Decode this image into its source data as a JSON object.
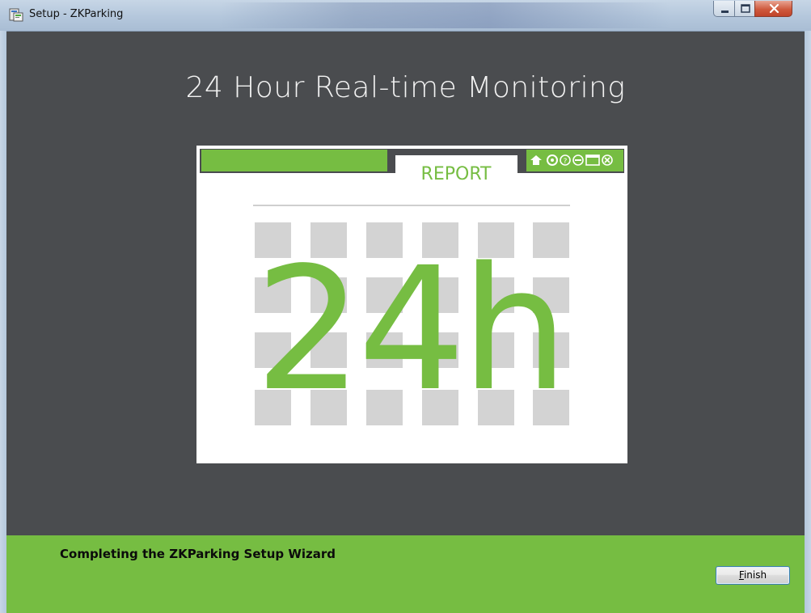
{
  "window": {
    "title": "Setup - ZKParking"
  },
  "banner": {
    "headline": "24 Hour Real-time Monitoring",
    "report_tab": "REPORT",
    "big_text": "24h",
    "accent_color": "#76bd42",
    "icons": [
      "home-icon",
      "gear-icon",
      "help-icon",
      "minimize-icon",
      "window-icon",
      "close-icon"
    ]
  },
  "footer": {
    "wizard_title": "Completing the ZKParking Setup Wizard",
    "finish_accel": "F",
    "finish_rest": "inish"
  }
}
